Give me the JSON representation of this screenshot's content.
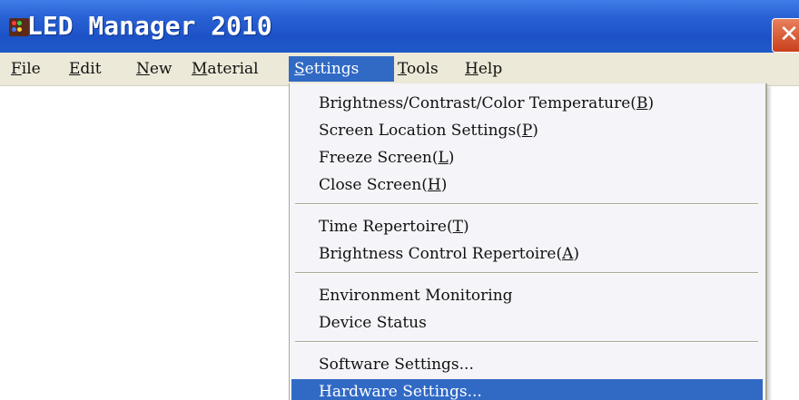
{
  "window": {
    "title": "LED Manager 2010",
    "close_glyph": "✕"
  },
  "menubar": {
    "items": [
      {
        "label": "File",
        "mnemonic": "F",
        "rest": "ile"
      },
      {
        "label": "Edit",
        "mnemonic": "E",
        "rest": "dit"
      },
      {
        "label": "New",
        "mnemonic": "N",
        "rest": "ew"
      },
      {
        "label": "Material",
        "mnemonic": "M",
        "rest": "aterial"
      },
      {
        "label": "Settings",
        "mnemonic": "S",
        "rest": "ettings"
      },
      {
        "label": "Tools",
        "mnemonic": "T",
        "rest": "ools"
      },
      {
        "label": "Help",
        "mnemonic": "H",
        "rest": "elp"
      }
    ]
  },
  "settings_menu": {
    "groups": [
      [
        {
          "text": "Brightness/Contrast/Color Temperature",
          "key": "B"
        },
        {
          "text": "Screen Location Settings",
          "key": "P"
        },
        {
          "text": "Freeze Screen",
          "key": "L"
        },
        {
          "text": "Close Screen",
          "key": "H"
        }
      ],
      [
        {
          "text": "Time Repertoire",
          "key": "T"
        },
        {
          "text": "Brightness Control Repertoire",
          "key": "A"
        }
      ],
      [
        {
          "text": "Environment Monitoring",
          "key": ""
        },
        {
          "text": "Device Status",
          "key": ""
        }
      ],
      [
        {
          "text": "Software Settings...",
          "key": ""
        },
        {
          "text": "Hardware Settings...",
          "key": ""
        }
      ]
    ]
  },
  "colors": {
    "titlebar": "#2a63d6",
    "menu_highlight": "#316ac5",
    "menubar_bg": "#ece9d8",
    "dropdown_bg": "#f5f4f8"
  }
}
